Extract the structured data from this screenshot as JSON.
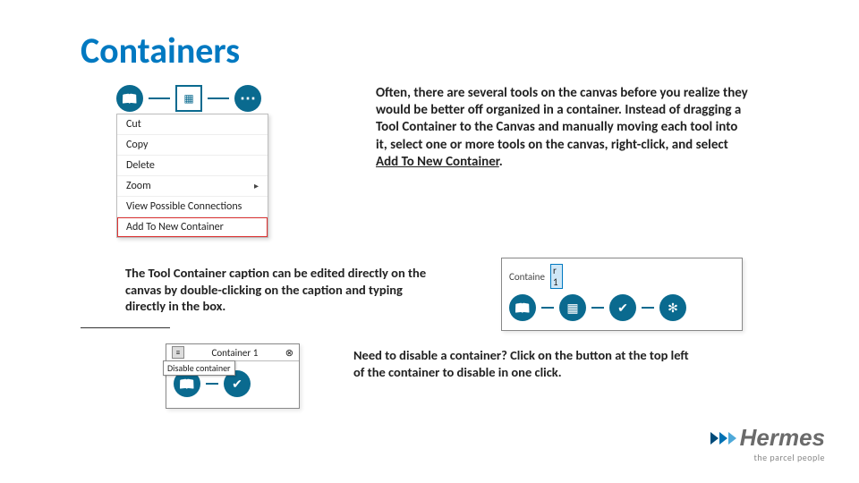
{
  "title": "Containers",
  "contextMenu": {
    "cut": "Cut",
    "copy": "Copy",
    "delete": "Delete",
    "zoom": "Zoom",
    "viewConn": "View Possible Connections",
    "addNew": "Add To New Container"
  },
  "para1_pre": "Often, there are several tools on the canvas before you realize they would be better off organized in a container. Instead of dragging a Tool Container to the Canvas and manually moving each tool into it, select one or more tools on the canvas, right-click, and select ",
  "para1_link": "Add To New Container",
  "para1_post": ".",
  "para2": "The Tool Container caption can be edited directly on the canvas by double-clicking on the caption and typing directly in the box.",
  "containerEdit": {
    "labelPrefix": "Containe",
    "editingChar": "r 1"
  },
  "disable": {
    "caption": "Container 1",
    "tooltip": "Disable container",
    "closeGlyph": "⊗"
  },
  "para3": "Need to disable a container? Click on the button at the top left of the container to disable in one click.",
  "logo": {
    "brand": "Hermes",
    "tagline": "the parcel people"
  }
}
